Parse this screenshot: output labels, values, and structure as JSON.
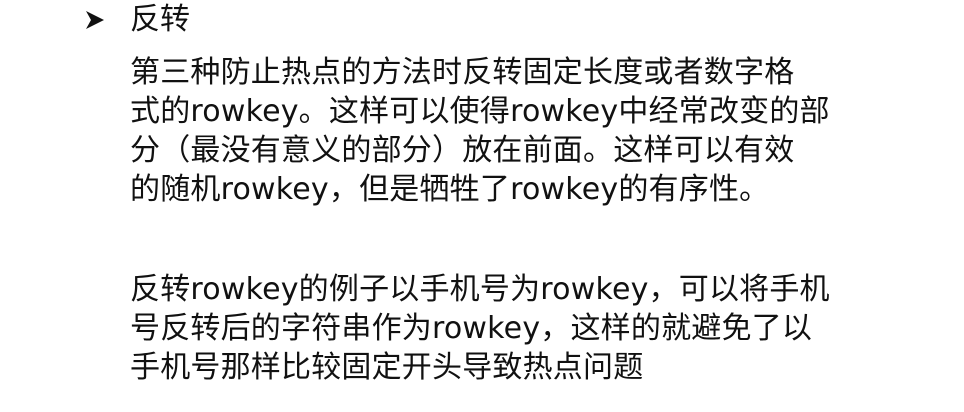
{
  "heading": "反转",
  "paragraph1": [
    "第三种防止热点的方法时反转固定长度或者数字格",
    "式的rowkey。这样可以使得rowkey中经常改变的部",
    "分（最没有意义的部分）放在前面。这样可以有效",
    "的随机rowkey，但是牺牲了rowkey的有序性。"
  ],
  "paragraph2": [
    "反转rowkey的例子以手机号为rowkey，可以将手机",
    "号反转后的字符串作为rowkey，这样的就避免了以",
    "手机号那样比较固定开头导致热点问题"
  ],
  "bullet_icon": "arrow-bullet-icon"
}
